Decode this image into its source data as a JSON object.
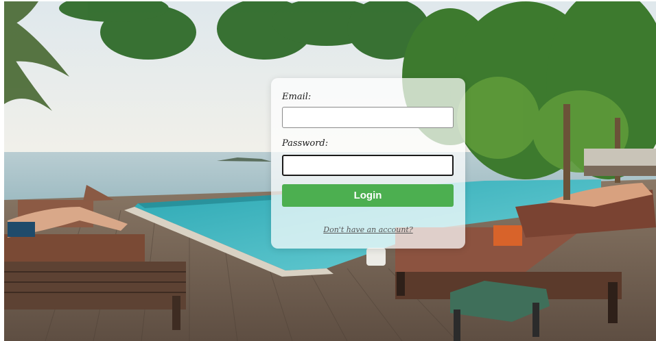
{
  "login": {
    "email_label": "Email:",
    "email_value": "",
    "password_label": "Password:",
    "password_value": "",
    "login_button_label": "Login",
    "signup_link_text": "Don't have an account?"
  },
  "background": {
    "description_icon": "resort-pool-background",
    "colors": {
      "sky": "#e8eef1",
      "sea": "#a9c5cc",
      "pool": "#3fb8c4",
      "deck": "#7a6a5c",
      "foliage": "#2f6b2a"
    }
  },
  "colors": {
    "button": "#4caf50",
    "button_text": "#ffffff",
    "card": "#ffffff"
  }
}
